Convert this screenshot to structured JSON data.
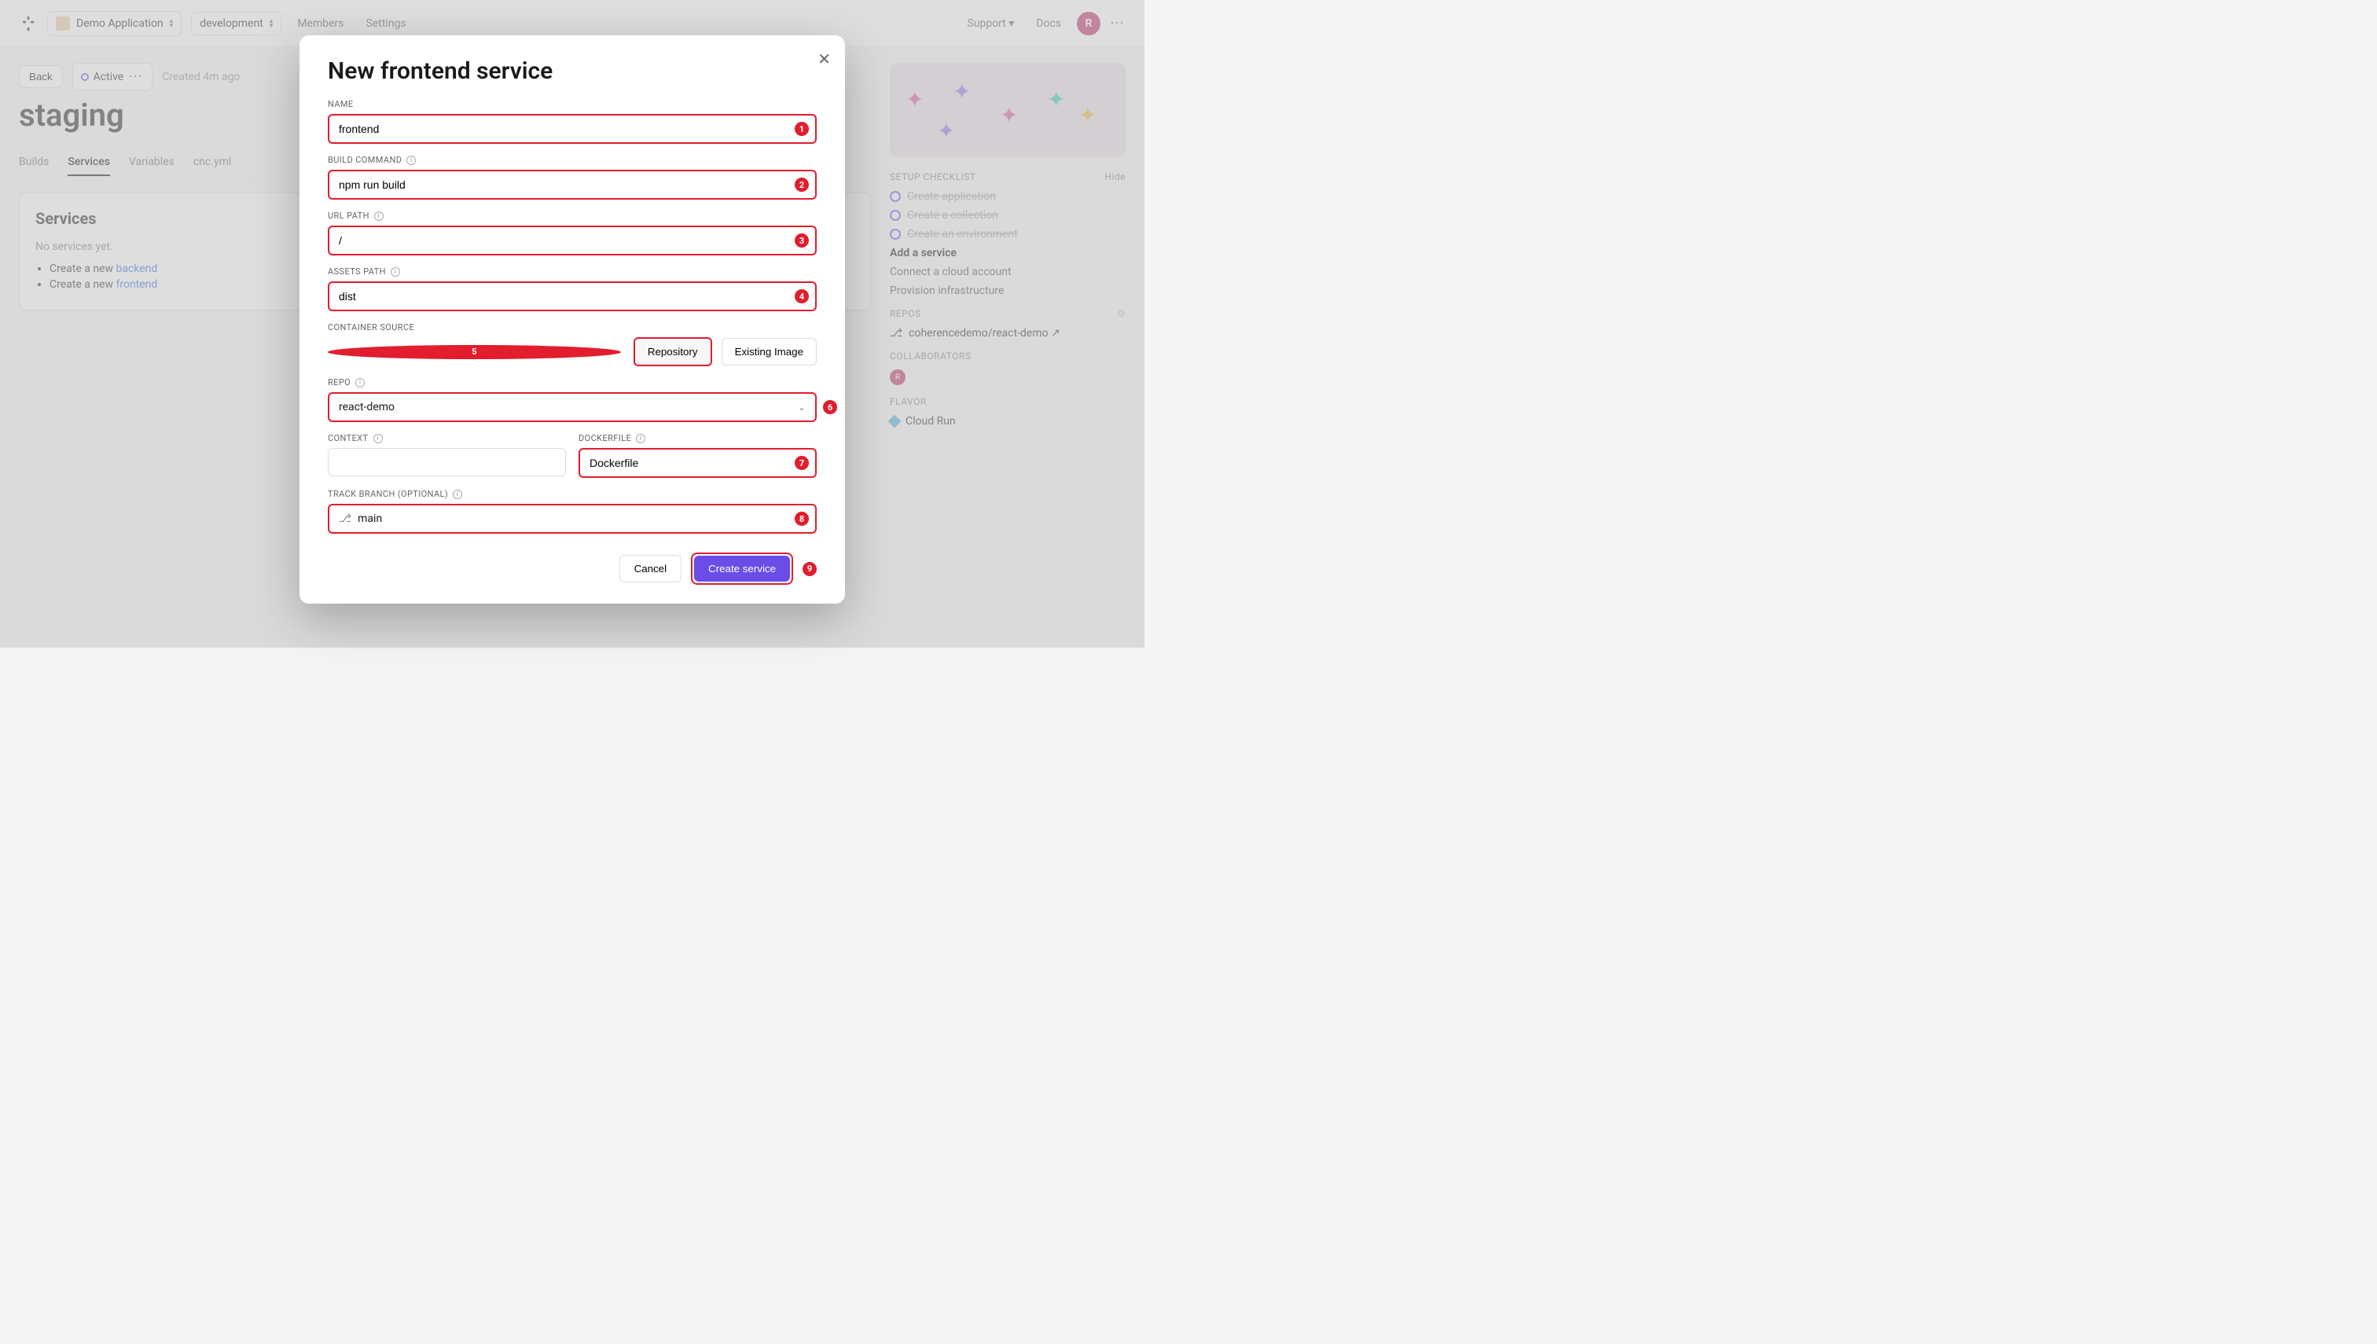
{
  "header": {
    "app_selector": "Demo Application",
    "env_selector": "development",
    "nav": {
      "members": "Members",
      "settings": "Settings"
    },
    "support": "Support",
    "docs": "Docs",
    "avatar_initial": "R"
  },
  "page": {
    "back": "Back",
    "status": "Active",
    "created": "Created 4m ago",
    "title": "staging",
    "tabs": {
      "builds": "Builds",
      "services": "Services",
      "variables": "Variables",
      "cnc": "cnc.yml"
    }
  },
  "services_card": {
    "title": "Services",
    "empty": "No services yet.",
    "create_prefix": "Create a new ",
    "backend": "backend",
    "frontend": "frontend"
  },
  "sidebar": {
    "checklist_title": "SETUP CHECKLIST",
    "hide": "Hide",
    "items": [
      "Create application",
      "Create a collection",
      "Create an environment",
      "Add a service",
      "Connect a cloud account",
      "Provision infrastructure"
    ],
    "repos_title": "REPOS",
    "repo": "coherencedemo/react-demo",
    "collab_title": "COLLABORATORS",
    "collab_initial": "R",
    "flavor_title": "FLAVOR",
    "flavor": "Cloud Run"
  },
  "modal": {
    "title": "New frontend service",
    "labels": {
      "name": "NAME",
      "build": "BUILD COMMAND",
      "url": "URL PATH",
      "assets": "ASSETS PATH",
      "container": "CONTAINER SOURCE",
      "repo": "REPO",
      "context": "CONTEXT",
      "dockerfile": "DOCKERFILE",
      "branch": "TRACK BRANCH (OPTIONAL)"
    },
    "values": {
      "name": "frontend",
      "build": "npm run build",
      "url": "/",
      "assets": "dist",
      "source_repo": "Repository",
      "source_existing": "Existing Image",
      "repo": "react-demo",
      "context": "",
      "dockerfile": "Dockerfile",
      "branch": "main"
    },
    "badges": {
      "1": "1",
      "2": "2",
      "3": "3",
      "4": "4",
      "5": "5",
      "6": "6",
      "7": "7",
      "8": "8",
      "9": "9"
    },
    "cancel": "Cancel",
    "create": "Create service"
  }
}
